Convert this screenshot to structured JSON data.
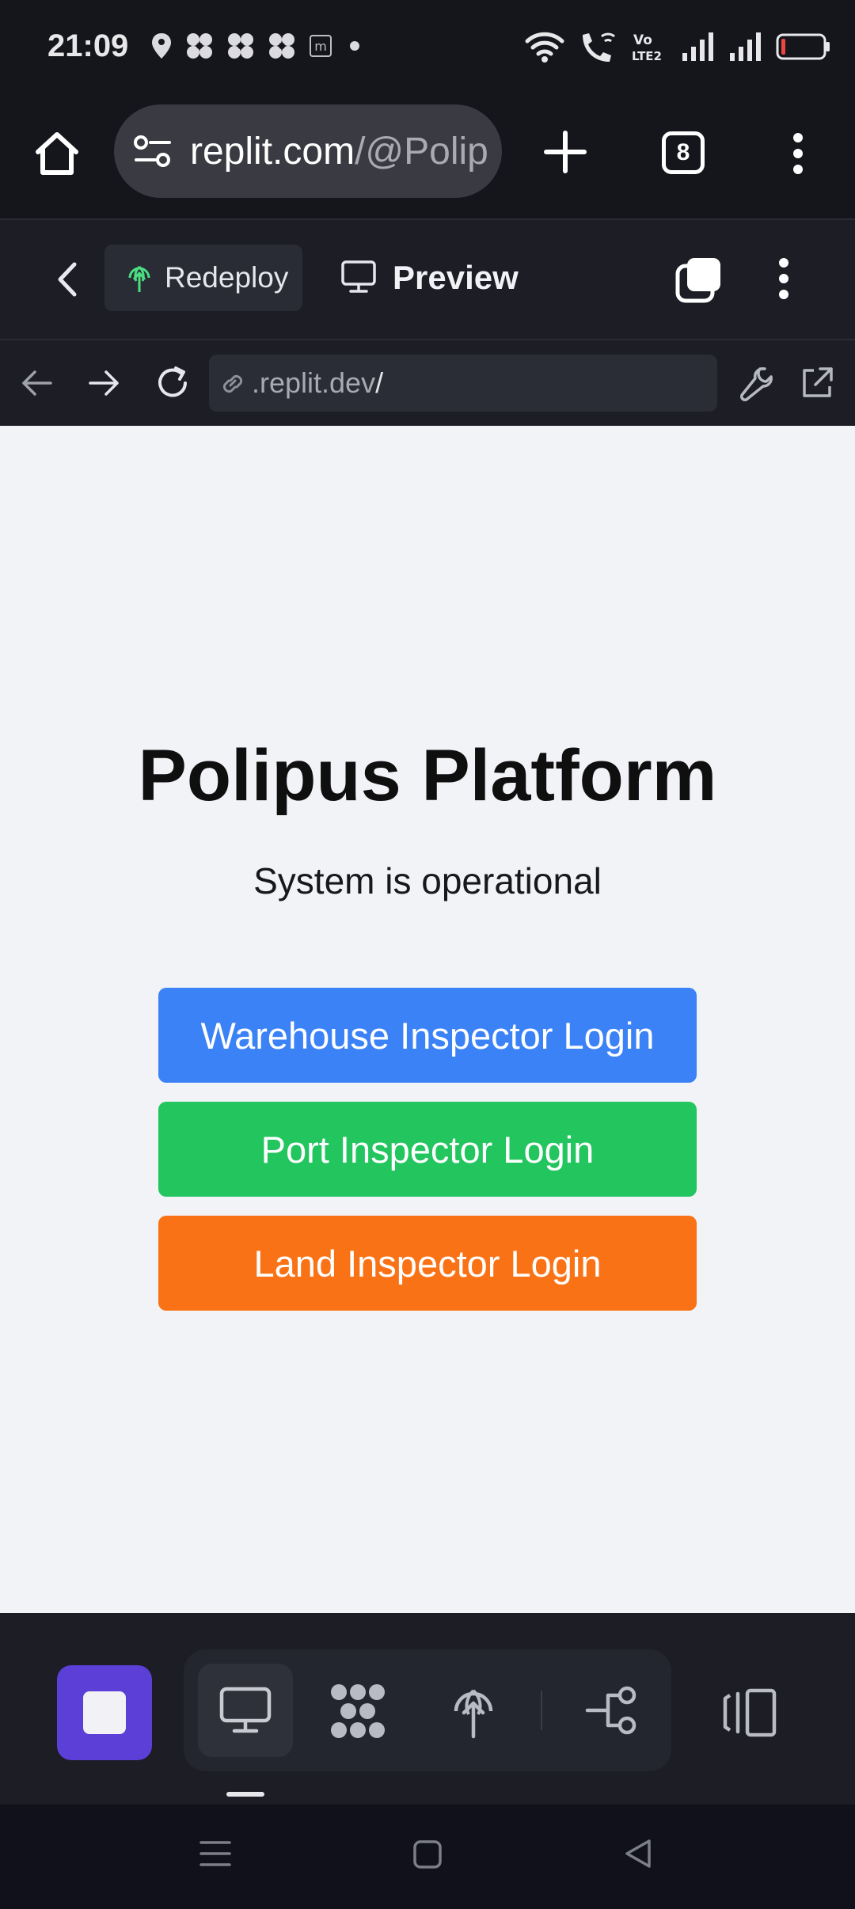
{
  "status_bar": {
    "time": "21:09",
    "notification_icons": [
      "location-pin-icon",
      "app-icon",
      "app-icon",
      "app-icon",
      "m-app-icon",
      "dot-icon"
    ],
    "system_icons": [
      "wifi-icon",
      "wifi-calling-icon",
      "volte-icon",
      "signal-icon",
      "signal-icon",
      "battery-low-icon"
    ],
    "volte_text": "Vo LTE2"
  },
  "browser": {
    "url_host": "replit.com",
    "url_path": "/@Polip",
    "tab_count": "8"
  },
  "replit_header": {
    "redeploy_label": "Redeploy",
    "preview_label": "Preview"
  },
  "webview_nav": {
    "address": ".replit.dev",
    "address_suffix": "/"
  },
  "page": {
    "title": "Polipus Platform",
    "subtitle": "System is operational",
    "buttons": [
      {
        "label": "Warehouse Inspector Login",
        "color": "#3b82f6"
      },
      {
        "label": "Port Inspector Login",
        "color": "#22c55e"
      },
      {
        "label": "Land Inspector Login",
        "color": "#f97316"
      }
    ]
  },
  "bottom_toolbar": {
    "stop_color": "#5b3fd6",
    "tools": [
      "desktop-preview-icon",
      "agent-logo-icon",
      "deploy-icon",
      "git-branch-icon",
      "devices-icon"
    ]
  },
  "colors": {
    "background_dark": "#15161c",
    "toolbar": "#1c1d25",
    "content_bg": "#f1f3f7"
  }
}
